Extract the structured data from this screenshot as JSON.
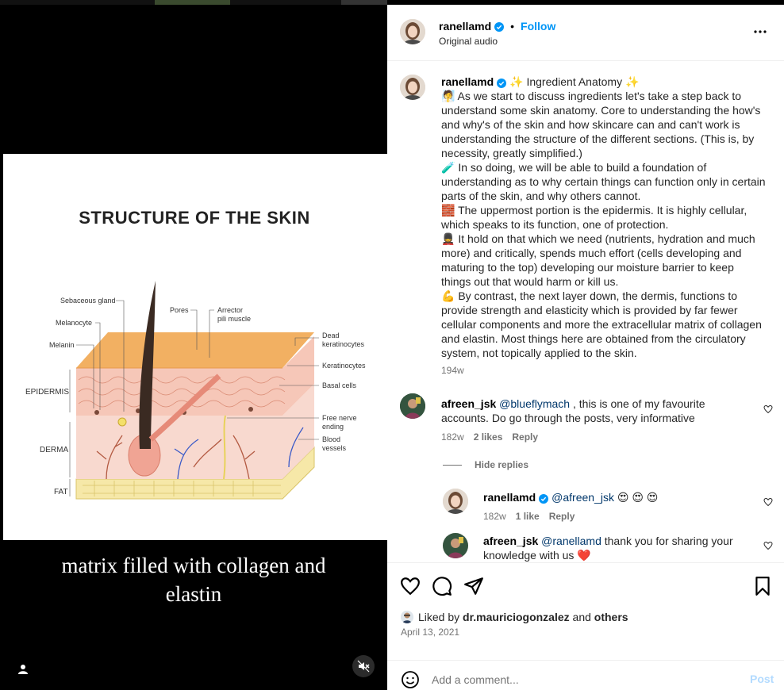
{
  "media": {
    "diagram_title": "STRUCTURE OF THE SKIN",
    "labels": {
      "sebaceous": "Sebaceous gland",
      "melanocyte": "Melanocyte",
      "melanin": "Melanin",
      "epidermis": "EPIDERMIS",
      "derma": "DERMA",
      "fat": "FAT",
      "pores": "Pores",
      "arrector1": "Arrector",
      "arrector2": "pili muscle",
      "dead1": "Dead",
      "dead2": "keratinocytes",
      "kerat": "Keratinocytes",
      "basal": "Basal cells",
      "nerve1": "Free nerve",
      "nerve2": "ending",
      "blood1": "Blood",
      "blood2": "vessels"
    },
    "caption_line1": "matrix filled with collagen and",
    "caption_line2": "elastin"
  },
  "header": {
    "username": "ranellamd",
    "separator": "•",
    "follow_label": "Follow",
    "audio": "Original audio"
  },
  "caption": {
    "username": "ranellamd",
    "title": "✨ Ingredient Anatomy ✨",
    "p1": "🧖 As we start to discuss ingredients let's take a step back to understand some skin anatomy. Core to understanding the how's and why's of the skin and how skincare can and can't work is understanding the structure of the different sections. (This is, by necessity, greatly simplified.)",
    "p2": "🧪 In so doing, we will be able to build a foundation of understanding as to why certain things can function only in certain parts of the skin, and why others cannot.",
    "p3": "🧱 The uppermost portion is the epidermis. It is highly cellular, which speaks to its function, one of protection.",
    "p4": "💂 It hold on that which we need (nutrients, hydration and much more) and critically, spends much effort (cells developing and maturing to the top) developing our moisture barrier to keep things out that would harm or kill us.",
    "p5": "💪 By contrast, the next layer down, the dermis, functions to provide strength and elasticity which is provided by far fewer cellular components and more the extracellular matrix of collagen and elastin. Most things here are obtained from the circulatory system, not topically applied to the skin.",
    "time": "194w"
  },
  "comments": [
    {
      "username": "afreen_jsk",
      "mention": "@blueflymach",
      "text": " , this is one of my favourite accounts. Do go through the posts, very informative",
      "time": "182w",
      "likes": "2 likes",
      "reply": "Reply"
    }
  ],
  "hide_replies": "Hide replies",
  "replies": [
    {
      "username": "ranellamd",
      "mention": "@afreen_jsk",
      "text": " 😍 😍 😍",
      "time": "182w",
      "likes": "1 like",
      "reply": "Reply"
    },
    {
      "username": "afreen_jsk",
      "mention": "@ranellamd",
      "text": " thank you for sharing your knowledge with us ❤️"
    }
  ],
  "likes": {
    "prefix": "Liked by ",
    "user": "dr.mauriciogonzalez",
    "and": " and ",
    "others": "others"
  },
  "date": "April 13, 2021",
  "add_comment": {
    "placeholder": "Add a comment...",
    "post_label": "Post"
  },
  "colors": {
    "accent": "#0095f6",
    "post_disabled": "#b3dbff"
  }
}
